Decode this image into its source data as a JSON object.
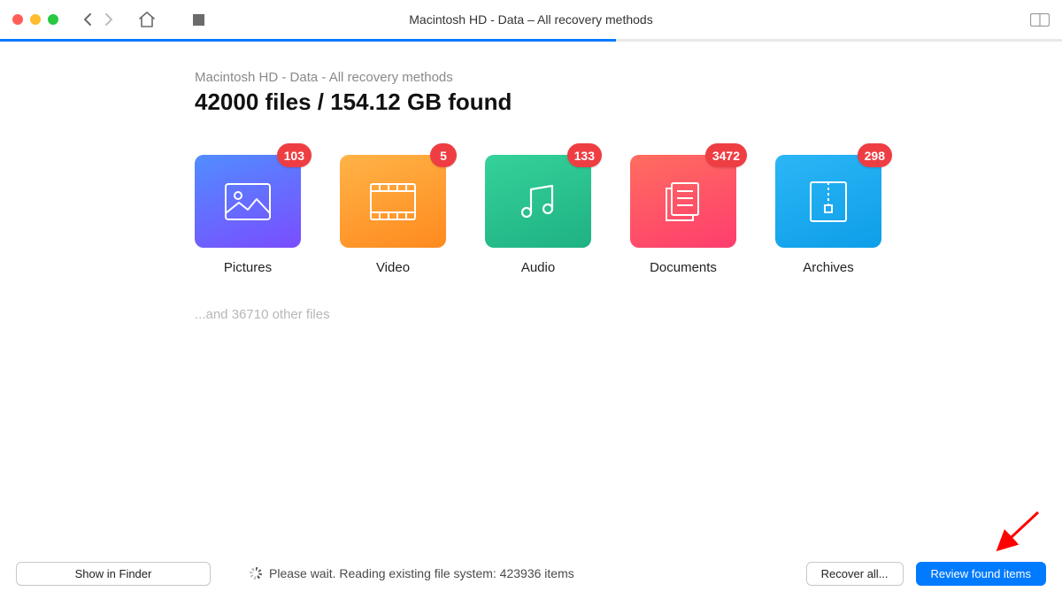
{
  "window": {
    "title": "Macintosh HD - Data – All recovery methods"
  },
  "breadcrumb": "Macintosh HD - Data - All recovery methods",
  "summary": "42000 files / 154.12 GB found",
  "categories": [
    {
      "key": "pictures",
      "label": "Pictures",
      "count": 103
    },
    {
      "key": "video",
      "label": "Video",
      "count": 5
    },
    {
      "key": "audio",
      "label": "Audio",
      "count": 133
    },
    {
      "key": "documents",
      "label": "Documents",
      "count": 3472
    },
    {
      "key": "archives",
      "label": "Archives",
      "count": 298
    }
  ],
  "other_files_text": "...and 36710 other files",
  "footer": {
    "show_in_finder": "Show in Finder",
    "status": "Please wait. Reading existing file system: 423936 items",
    "recover_all": "Recover all...",
    "review": "Review found items"
  },
  "progress_percent": 58
}
